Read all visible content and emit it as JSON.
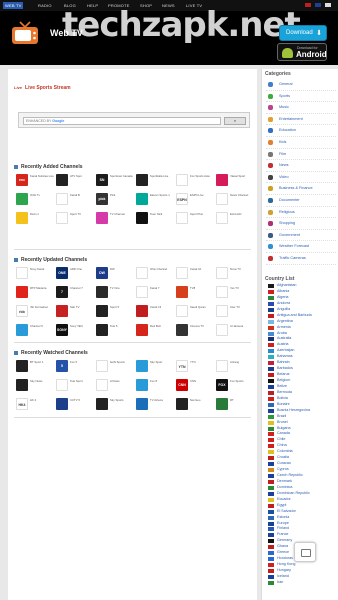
{
  "topnav": {
    "items": [
      "WEB TV",
      "RADIO",
      "BLOG",
      "HELP",
      "PROMOTE",
      "SHOP",
      "NEWS",
      "LIVE TV"
    ],
    "watermark": "techzapk.net"
  },
  "header": {
    "brand": "Web TV",
    "download_label": "Download",
    "badge_small": "Download for",
    "badge_big": "Android"
  },
  "main": {
    "live_tag": "Live",
    "live_title": "Live Sports Stream",
    "search_prefix": "ENHANCED BY",
    "search_google": "Google",
    "recently_added_title": "Recently Added Channels",
    "recently_updated_title": "Recently Updated Channels",
    "recently_watched_title": "Recently Watched Channels",
    "recently_added": [
      {
        "name": "Kanal Noticias Live",
        "logo": "enc",
        "color": "#d6261c"
      },
      {
        "name": "ATV Spor",
        "logo": "",
        "color": "#222"
      },
      {
        "name": "Sportsnet Canada",
        "logo": "SN",
        "color": "#1c1c1c"
      },
      {
        "name": "Sportitalia Live",
        "logo": "",
        "color": "#222"
      },
      {
        "name": "Fox Sports Asia",
        "logo": "",
        "color": "#ffffff"
      },
      {
        "name": "Viasat Sport",
        "logo": "",
        "color": "#d61b5b"
      },
      {
        "name": "Orbit Tv",
        "logo": "",
        "color": "#2da44e"
      },
      {
        "name": "Kanal B",
        "logo": "",
        "color": "#ffffff"
      },
      {
        "name": "Pick",
        "logo": "pick",
        "color": "#333"
      },
      {
        "name": "Eleven Sports 1",
        "logo": "",
        "color": "#00a89a"
      },
      {
        "name": "ESPN Live",
        "logo": "ESPN",
        "color": "#ffffff"
      },
      {
        "name": "News Channel",
        "logo": "",
        "color": "#ffffff"
      },
      {
        "name": "Dazn 1",
        "logo": "",
        "color": "#f4c21c"
      },
      {
        "name": "Sport TV",
        "logo": "",
        "color": "#ffffff"
      },
      {
        "name": "TV Channel",
        "logo": "",
        "color": "#d63aa8"
      },
      {
        "name": "Teen Nick",
        "logo": "",
        "color": "#111"
      },
      {
        "name": "Sport Plus",
        "logo": "",
        "color": "#ffffff"
      },
      {
        "name": "Extra HD",
        "logo": "",
        "color": "#fff"
      }
    ],
    "recently_updated": [
      {
        "name": "Novy Kanal",
        "logo": "",
        "color": "#ffffff"
      },
      {
        "name": "ARD One",
        "logo": "ONE",
        "color": "#0a2d6b"
      },
      {
        "name": "DW",
        "logo": "DW",
        "color": "#1d3c8a"
      },
      {
        "name": "Ohio Channel",
        "logo": "",
        "color": "#ffffff"
      },
      {
        "name": "Canal 10",
        "logo": "",
        "color": "#fff"
      },
      {
        "name": "Nova TV",
        "logo": "",
        "color": "#ffffff"
      },
      {
        "name": "RTP Madeira",
        "logo": "",
        "color": "#e0241c"
      },
      {
        "name": "Channel 7",
        "logo": "7",
        "color": "#1b1b1b"
      },
      {
        "name": "TV One",
        "logo": "",
        "color": "#2a2a2a"
      },
      {
        "name": "Kanal 7",
        "logo": "",
        "color": "#ffffff"
      },
      {
        "name": "TV8",
        "logo": "",
        "color": "#d63f1c"
      },
      {
        "name": "Yes TV",
        "logo": "",
        "color": "#ffffff"
      },
      {
        "name": "rbb Fernsehen",
        "logo": "rbb",
        "color": "#ffffff"
      },
      {
        "name": "Star TV",
        "logo": "",
        "color": "#c62222"
      },
      {
        "name": "Sport 5",
        "logo": "",
        "color": "#222"
      },
      {
        "name": "Canal 13",
        "logo": "",
        "color": "#c11f1f"
      },
      {
        "name": "Saudi Quran",
        "logo": "",
        "color": "#ffffff"
      },
      {
        "name": "Inter TV",
        "logo": "",
        "color": "#ffffff"
      },
      {
        "name": "Channel 5",
        "logo": "",
        "color": "#2a9bd9"
      },
      {
        "name": "Sony TEN",
        "logo": "SONY",
        "color": "#101010"
      },
      {
        "name": "Tele 5",
        "logo": "",
        "color": "#222"
      },
      {
        "name": "Red Bull",
        "logo": "",
        "color": "#d6261c"
      },
      {
        "name": "Cinema TV",
        "logo": "",
        "color": "#333"
      },
      {
        "name": "Al Jazeera",
        "logo": "",
        "color": "#ffffff"
      }
    ],
    "recently_watched": [
      {
        "name": "BT Sport 1",
        "logo": "",
        "color": "#222"
      },
      {
        "name": "Fox 5",
        "logo": "5",
        "color": "#2452a8"
      },
      {
        "name": "beIN Sports",
        "logo": "",
        "color": "#ffffff"
      },
      {
        "name": "Sky Sport",
        "logo": "",
        "color": "#2a9bd9"
      },
      {
        "name": "YTN",
        "logo": "YTN",
        "color": "#ffffff"
      },
      {
        "name": "Arirang",
        "logo": "",
        "color": "#ffffff"
      },
      {
        "name": "Sky News",
        "logo": "",
        "color": "#222"
      },
      {
        "name": "Tele Sport",
        "logo": "",
        "color": "#ffffff"
      },
      {
        "name": "Al Kass",
        "logo": "",
        "color": "#ffffff"
      },
      {
        "name": "Fox 8",
        "logo": "",
        "color": "#2a9bd9"
      },
      {
        "name": "CNN",
        "logo": "CNN",
        "color": "#cc0000"
      },
      {
        "name": "Fox Sports",
        "logo": "FOX",
        "color": "#111"
      },
      {
        "name": "HK 4",
        "logo": "HK4",
        "color": "#ffffff"
      },
      {
        "name": "CCTV 5",
        "logo": "",
        "color": "#1b3f8a"
      },
      {
        "name": "Sky Sports",
        "logo": "",
        "color": "#222"
      },
      {
        "name": "TV Azteca",
        "logo": "",
        "color": "#1b6fb8"
      },
      {
        "name": "Nat Geo",
        "logo": "",
        "color": "#222"
      },
      {
        "name": "RT",
        "logo": "",
        "color": "#2a7a3a"
      }
    ]
  },
  "sidebar": {
    "categories_title": "Categories",
    "categories": [
      {
        "label": "General",
        "color": "#3f7fd0"
      },
      {
        "label": "Sports",
        "color": "#3faa3f"
      },
      {
        "label": "Music",
        "color": "#c04090"
      },
      {
        "label": "Entertainment",
        "color": "#e0a030"
      },
      {
        "label": "Education",
        "color": "#3070c0"
      },
      {
        "label": "Kids",
        "color": "#e08030"
      },
      {
        "label": "Film",
        "color": "#777777"
      },
      {
        "label": "News",
        "color": "#c03030"
      },
      {
        "label": "Video",
        "color": "#444444"
      },
      {
        "label": "Business & Finance",
        "color": "#d0a020"
      },
      {
        "label": "Documenter",
        "color": "#2a6a9a"
      },
      {
        "label": "Religious",
        "color": "#d0a030"
      },
      {
        "label": "Shopping",
        "color": "#b03070"
      },
      {
        "label": "Government",
        "color": "#3a5a8a"
      },
      {
        "label": "Weather Forecast",
        "color": "#3090d0"
      },
      {
        "label": "Traffic Cameras",
        "color": "#c03030"
      }
    ],
    "country_title": "Country List",
    "countries": [
      {
        "label": "Afghanistan",
        "color": "#1b1b1b"
      },
      {
        "label": "Albania",
        "color": "#d01f1f"
      },
      {
        "label": "Algeria",
        "color": "#2a8a3a"
      },
      {
        "label": "Andorra",
        "color": "#2a4ab0"
      },
      {
        "label": "Anguilla",
        "color": "#1b3f8a"
      },
      {
        "label": "Antigua and Barbuda",
        "color": "#c01f1f"
      },
      {
        "label": "Argentina",
        "color": "#7ab8e0"
      },
      {
        "label": "Armenia",
        "color": "#d0301f"
      },
      {
        "label": "Aruba",
        "color": "#4a8ad0"
      },
      {
        "label": "Australia",
        "color": "#1b2f7a"
      },
      {
        "label": "Austria",
        "color": "#d01f1f"
      },
      {
        "label": "Azerbaijan",
        "color": "#2a8ad0"
      },
      {
        "label": "Bahamas",
        "color": "#2ab0c0"
      },
      {
        "label": "Bahrain",
        "color": "#c01f3f"
      },
      {
        "label": "Barbados",
        "color": "#1b3f8a"
      },
      {
        "label": "Belarus",
        "color": "#c01f1f"
      },
      {
        "label": "Belgium",
        "color": "#111111"
      },
      {
        "label": "Belize",
        "color": "#1b3fa0"
      },
      {
        "label": "Bermuda",
        "color": "#c01f1f"
      },
      {
        "label": "Bolivia",
        "color": "#d01f1f"
      },
      {
        "label": "Bonaire",
        "color": "#2a6ab0"
      },
      {
        "label": "Bosnia Herzegovina",
        "color": "#1b3f9a"
      },
      {
        "label": "Brazil",
        "color": "#2a9a3a"
      },
      {
        "label": "Brunei",
        "color": "#e0c020"
      },
      {
        "label": "Bulgaria",
        "color": "#2a8a3a"
      },
      {
        "label": "Canada",
        "color": "#d01f1f"
      },
      {
        "label": "Chile",
        "color": "#d01f1f"
      },
      {
        "label": "China",
        "color": "#d01f1f"
      },
      {
        "label": "Colombia",
        "color": "#e0c020"
      },
      {
        "label": "Croatia",
        "color": "#c01f1f"
      },
      {
        "label": "Curacao",
        "color": "#1b3f9a"
      },
      {
        "label": "Cyprus",
        "color": "#d08a20"
      },
      {
        "label": "Czech Republic",
        "color": "#1b3f9a"
      },
      {
        "label": "Denmark",
        "color": "#c01f1f"
      },
      {
        "label": "Dominica",
        "color": "#2a8a3a"
      },
      {
        "label": "Dominican Republic",
        "color": "#1b3f9a"
      },
      {
        "label": "Ecuador",
        "color": "#e0c020"
      },
      {
        "label": "Egypt",
        "color": "#c01f1f"
      },
      {
        "label": "El Salvador",
        "color": "#1b4fa0"
      },
      {
        "label": "Estonia",
        "color": "#2a6ab0"
      },
      {
        "label": "Europe",
        "color": "#1b3f9a"
      },
      {
        "label": "Finland",
        "color": "#2a5ab0"
      },
      {
        "label": "France",
        "color": "#1b3f9a"
      },
      {
        "label": "Germany",
        "color": "#111111"
      },
      {
        "label": "Ghana",
        "color": "#c01f1f"
      },
      {
        "label": "Greece",
        "color": "#2a6ad0"
      },
      {
        "label": "Honduras",
        "color": "#2a6ad0"
      },
      {
        "label": "Hong Kong",
        "color": "#d01f1f"
      },
      {
        "label": "Hungary",
        "color": "#c01f1f"
      },
      {
        "label": "Iceland",
        "color": "#1b3f9a"
      },
      {
        "label": "Iran",
        "color": "#2a8a3a"
      }
    ]
  }
}
